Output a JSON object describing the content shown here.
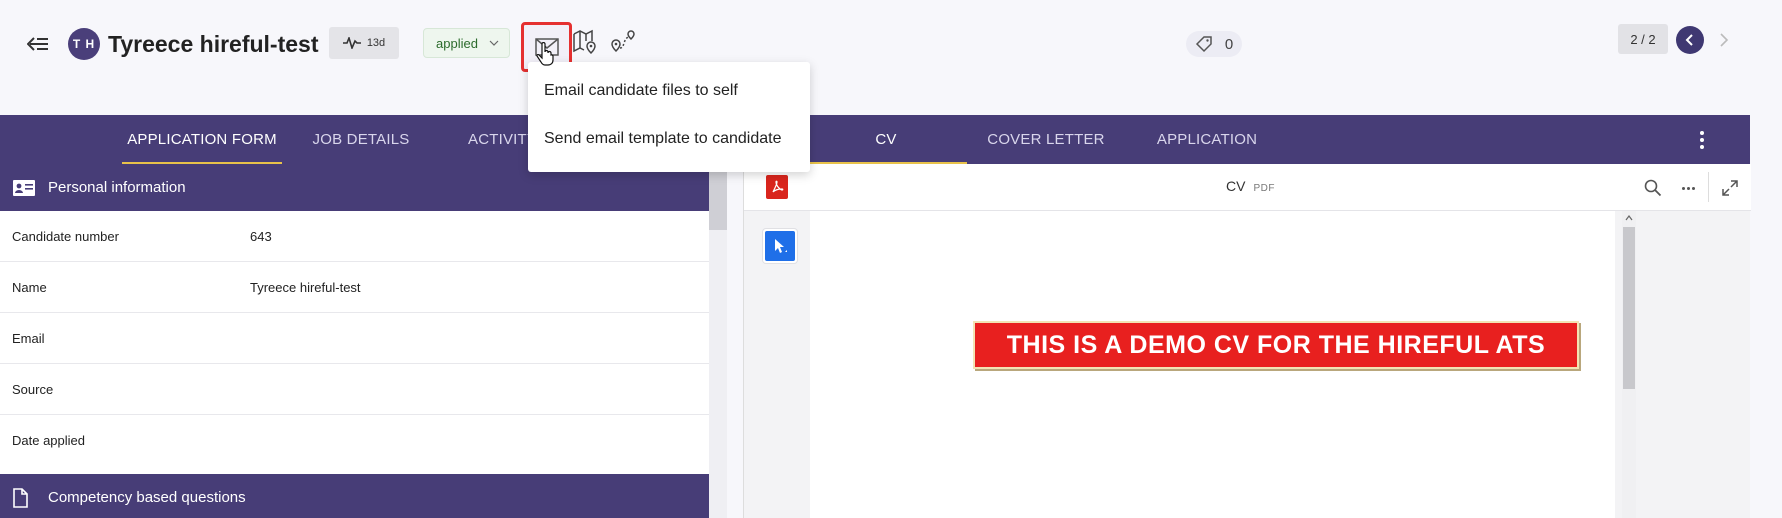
{
  "header": {
    "avatar_initials": "T H",
    "candidate_name": "Tyreece hireful-test",
    "activity_days": "13d",
    "status": "applied",
    "tag_count": "0",
    "pager": "2 / 2"
  },
  "email_menu": {
    "items": [
      {
        "label": "Email candidate files to self"
      },
      {
        "label": "Send email template to candidate"
      }
    ]
  },
  "tabs": [
    {
      "label": "APPLICATION FORM",
      "active": true
    },
    {
      "label": "JOB DETAILS"
    },
    {
      "label": "ACTIVITY"
    },
    {
      "label": "CV",
      "active": true
    },
    {
      "label": "COVER LETTER"
    },
    {
      "label": "APPLICATION"
    }
  ],
  "personal_info": {
    "title": "Personal information",
    "rows": [
      {
        "label": "Candidate number",
        "value": "643"
      },
      {
        "label": "Name",
        "value": "Tyreece hireful-test"
      },
      {
        "label": "Email",
        "value": ""
      },
      {
        "label": "Source",
        "value": ""
      },
      {
        "label": "Date applied",
        "value": ""
      }
    ]
  },
  "competency": {
    "title": "Competency based questions"
  },
  "viewer": {
    "doc_title": "CV",
    "doc_type": "PDF",
    "banner_text": "THIS IS A DEMO CV FOR THE HIREFUL ATS"
  },
  "colors": {
    "brand": "#473d77",
    "accent": "#e8c24a",
    "highlight": "#e53030"
  }
}
